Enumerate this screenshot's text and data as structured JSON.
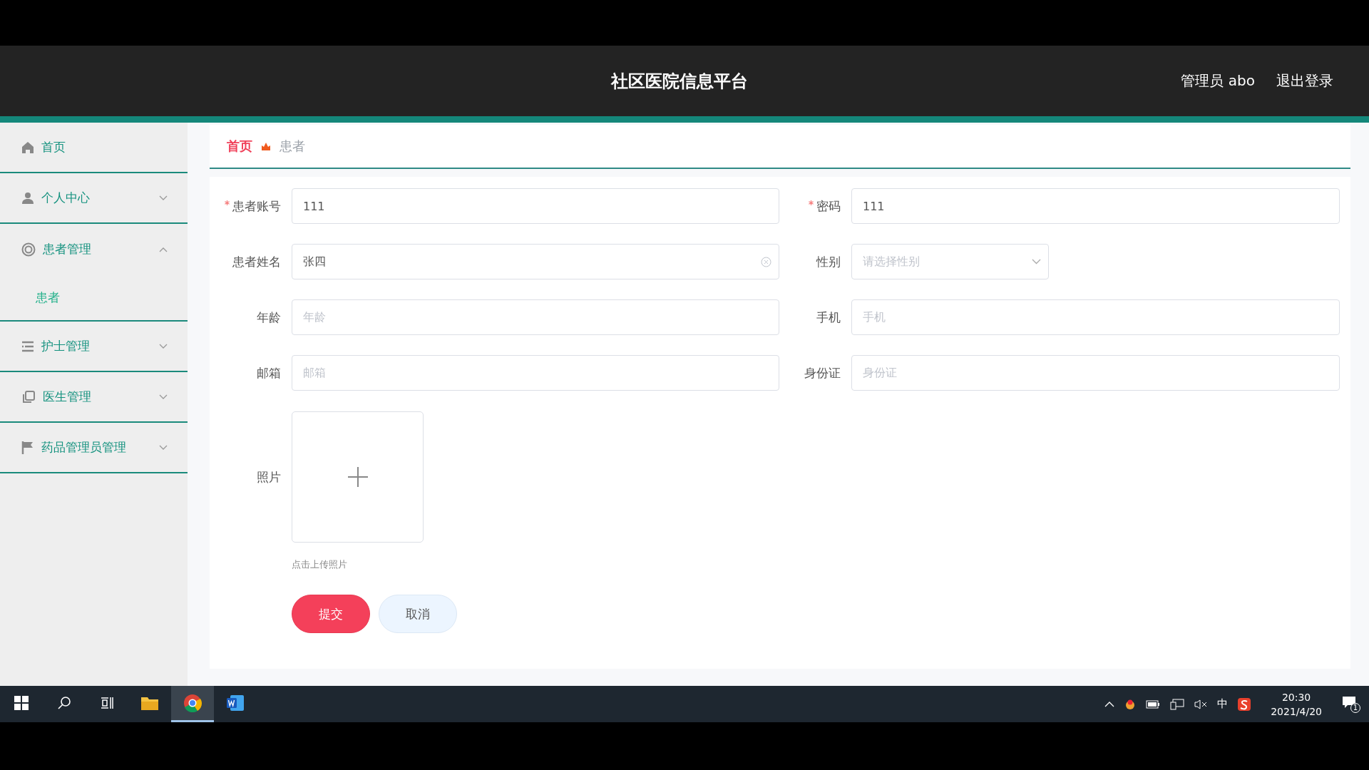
{
  "header": {
    "title": "社区医院信息平台",
    "user": "管理员 abo",
    "logout": "退出登录"
  },
  "sidebar": {
    "items": [
      {
        "kind": "link",
        "label": "首页"
      },
      {
        "kind": "submenu",
        "label": "个人中心",
        "expanded": false
      },
      {
        "kind": "submenu",
        "label": "患者管理",
        "expanded": true,
        "children": [
          {
            "label": "患者",
            "selected": true
          }
        ]
      },
      {
        "kind": "submenu",
        "label": "护士管理",
        "expanded": false
      },
      {
        "kind": "submenu",
        "label": "医生管理",
        "expanded": false
      },
      {
        "kind": "submenu",
        "label": "药品管理员管理",
        "expanded": false
      }
    ]
  },
  "breadcrumb": [
    {
      "label": "首页",
      "selected": false
    },
    {
      "label": "患者",
      "selected": true
    }
  ],
  "form": {
    "fields": [
      {
        "kind": "text",
        "label": "患者账号",
        "required": true,
        "value": "111",
        "clear_button": false
      },
      {
        "kind": "text",
        "label": "密码",
        "required": true,
        "value": "111",
        "clear_button": false
      },
      {
        "kind": "text",
        "label": "患者姓名",
        "required": false,
        "value": "张四",
        "clear_button": true
      },
      {
        "kind": "select",
        "label": "性别",
        "required": false,
        "placeholder": "请选择性别"
      },
      {
        "kind": "text",
        "label": "年龄",
        "required": false,
        "placeholder": "年龄",
        "clear_button": false
      },
      {
        "kind": "text",
        "label": "手机",
        "required": false,
        "placeholder": "手机",
        "clear_button": false
      },
      {
        "kind": "text",
        "label": "邮箱",
        "required": false,
        "placeholder": "邮箱",
        "clear_button": false
      },
      {
        "kind": "text",
        "label": "身份证",
        "required": false,
        "placeholder": "身份证",
        "clear_button": false
      }
    ],
    "photo": {
      "label": "照片",
      "hint": "点击上传照片"
    },
    "buttons": [
      {
        "kind": "primary",
        "label": "提交"
      },
      {
        "kind": "secondary",
        "label": "取消"
      }
    ]
  },
  "taskbar": {
    "apps": [
      {
        "selected": false
      },
      {
        "selected": true
      },
      {
        "selected": false
      }
    ],
    "ime": "中",
    "time": "20:30",
    "date": "2021/4/20",
    "notifications": "1"
  }
}
